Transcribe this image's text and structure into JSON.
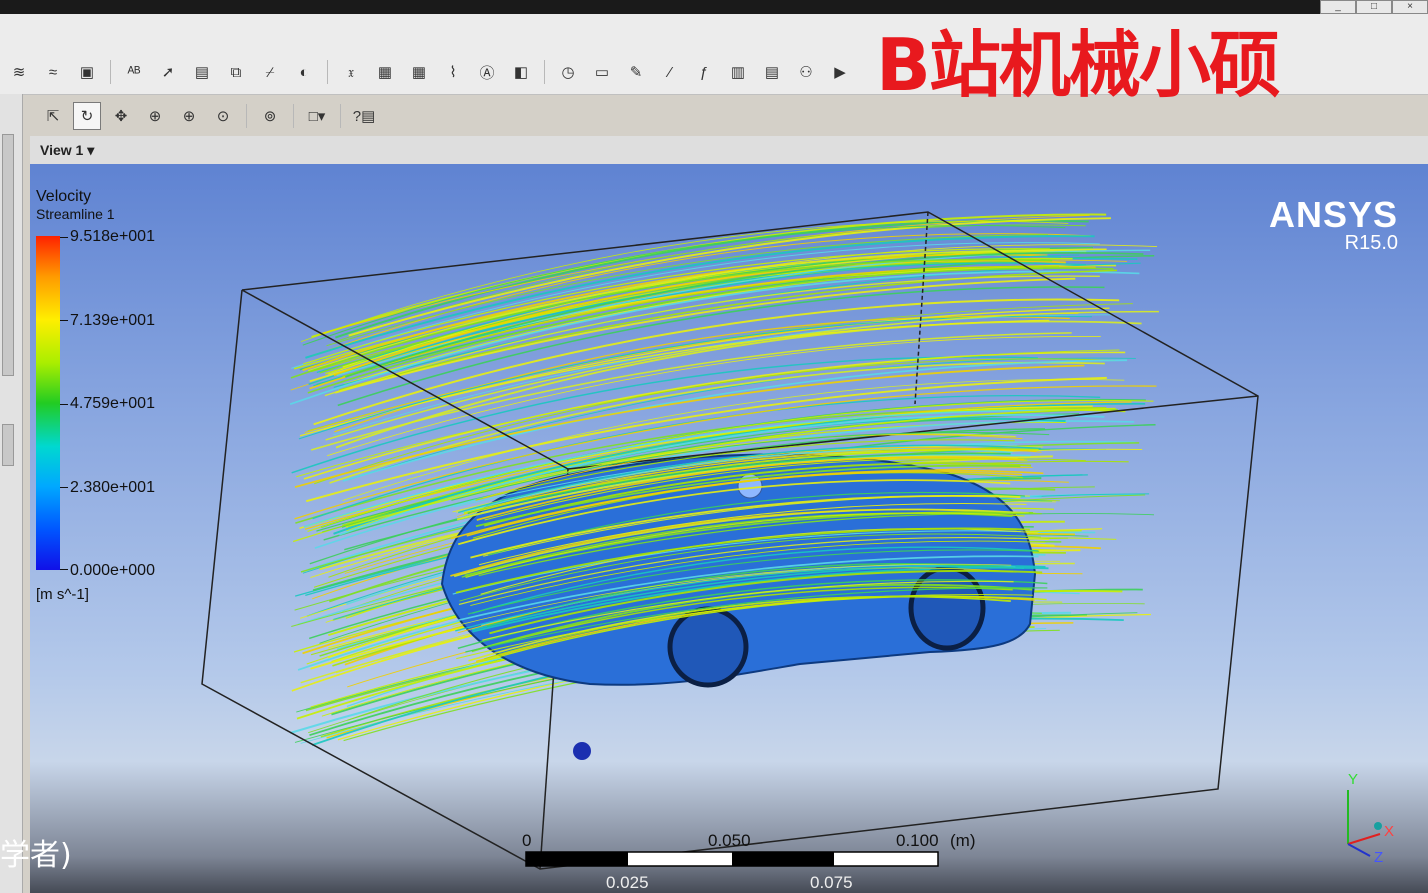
{
  "watermark": "B站机械小硕",
  "window_buttons": [
    "_",
    "□",
    "×"
  ],
  "view": {
    "label": "View 1",
    "dropdown_glyph": "▾"
  },
  "legend": {
    "title": "Velocity",
    "subtitle": "Streamline 1",
    "ticks": [
      "9.518e+001",
      "7.139e+001",
      "4.759e+001",
      "2.380e+001",
      "0.000e+000"
    ],
    "unit": "[m s^-1]"
  },
  "brand": {
    "name": "ANSYS",
    "version": "R15.0"
  },
  "scale": {
    "top_labels": [
      "0",
      "0.050",
      "0.100",
      "(m)"
    ],
    "bottom_labels": [
      "0.025",
      "0.075"
    ]
  },
  "axes": {
    "y": "Y",
    "x": "X",
    "z": "Z"
  },
  "caption": "学者)",
  "colors": {
    "viewport_top": "#5f83d2",
    "car_body": "#2a6fd8",
    "watermark": "#e8191e"
  },
  "toolbar1_icons": [
    "streamline-icon",
    "contour-icon",
    "volume-icon",
    "text-icon",
    "vector-icon",
    "legend-icon",
    "group-icon",
    "clip-icon",
    "color-icon",
    "function-icon",
    "expression-icon",
    "table-icon",
    "chart-icon",
    "annotation-icon",
    "variable-icon",
    "timestep-icon",
    "animation-icon",
    "quick-edit-icon",
    "probe-icon",
    "calculator-icon",
    "report-icon",
    "file-icon",
    "case-icon",
    "command-icon"
  ],
  "toolbar2_icons": [
    "select-icon",
    "rotate-icon",
    "pan-icon",
    "zoom-icon",
    "zoom-box-icon",
    "zoom-fit-icon",
    "fit-view-icon",
    "viewport-layout-icon",
    "help-icon"
  ]
}
